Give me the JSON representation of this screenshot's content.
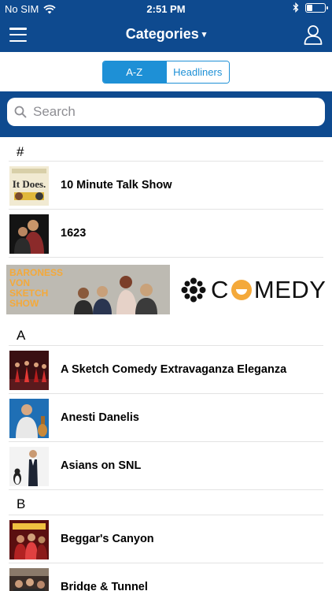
{
  "status_bar": {
    "carrier": "No SIM",
    "time": "2:51 PM",
    "battery_level": 0.35,
    "icons": [
      "wifi-icon",
      "bluetooth-icon",
      "battery-icon"
    ]
  },
  "nav": {
    "title": "Categories",
    "caret": "▾",
    "menu_icon": "hamburger-icon",
    "user_icon": "user-icon"
  },
  "segments": {
    "az_label": "A-Z",
    "headliners_label": "Headliners",
    "selected": "A-Z"
  },
  "search": {
    "placeholder": "Search"
  },
  "sections": [
    {
      "header": "#",
      "items": [
        {
          "label": "10 Minute Talk Show",
          "thumb_text": "It Does."
        },
        {
          "label": "1623"
        }
      ]
    },
    {
      "header": "A",
      "items": [
        {
          "label": "A Sketch Comedy Extravaganza Eleganza"
        },
        {
          "label": "Anesti Danelis"
        },
        {
          "label": "Asians on SNL"
        }
      ]
    },
    {
      "header": "B",
      "items": [
        {
          "label": "Beggar's Canyon"
        },
        {
          "label": "Bridge & Tunnel"
        }
      ]
    }
  ],
  "banner": {
    "show_text_1": "BARONESS",
    "show_text_2": "VON",
    "show_text_3": "SKETCH",
    "show_text_4": "SHOW",
    "logo_text_c": "C",
    "logo_text_rest": "MEDY"
  },
  "colors": {
    "brand_blue": "#0e4a8f",
    "accent_blue": "#1e90d6",
    "banner_orange": "#f4a93a"
  }
}
